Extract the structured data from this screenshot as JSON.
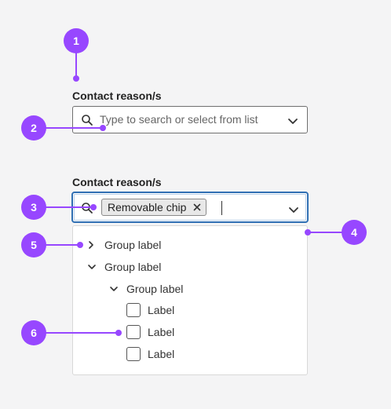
{
  "field_closed": {
    "label": "Contact reason/s",
    "placeholder": "Type to search or select from list"
  },
  "field_open": {
    "label": "Contact reason/s",
    "chip_label": "Removable chip"
  },
  "dropdown": {
    "items": [
      {
        "type": "group",
        "label": "Group label",
        "state": "collapsed"
      },
      {
        "type": "group",
        "label": "Group label",
        "state": "expanded"
      },
      {
        "type": "group",
        "label": "Group label",
        "state": "expanded"
      },
      {
        "type": "option",
        "label": "Label",
        "checked": false
      },
      {
        "type": "option",
        "label": "Label",
        "checked": false
      },
      {
        "type": "option",
        "label": "Label",
        "checked": false
      }
    ]
  },
  "callouts": [
    "1",
    "2",
    "3",
    "4",
    "5",
    "6"
  ],
  "colors": {
    "callout": "#9747ff",
    "focus_border": "#2f6fb3"
  },
  "icons": [
    "search-icon",
    "chevron-down-icon",
    "close-icon",
    "chevron-right-icon"
  ]
}
